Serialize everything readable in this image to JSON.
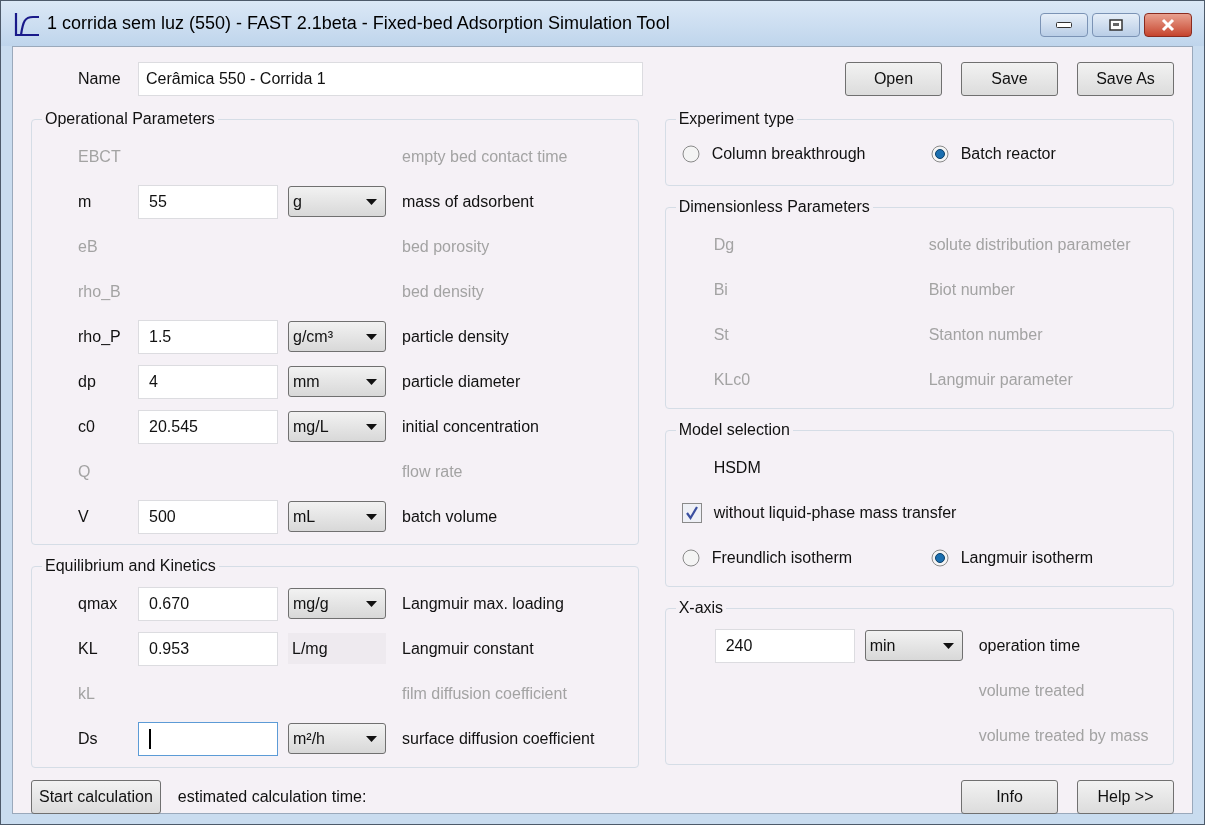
{
  "window": {
    "title": "1 corrida sem luz (550) - FAST 2.1beta - Fixed-bed Adsorption Simulation Tool"
  },
  "name": {
    "label": "Name",
    "value": "Cerâmica 550 - Corrida 1"
  },
  "file_buttons": [
    "Open",
    "Save",
    "Save As"
  ],
  "operational_parameters": {
    "title": "Operational Parameters",
    "rows": [
      {
        "kind": "disabled",
        "symbol": "EBCT",
        "description": "empty bed contact time"
      },
      {
        "kind": "select",
        "symbol": "m",
        "value": "55",
        "unit": "g",
        "description": "mass of adsorbent",
        "focused": false
      },
      {
        "kind": "disabled",
        "symbol": "eB",
        "description": "bed porosity"
      },
      {
        "kind": "disabled",
        "symbol": "rho_B",
        "description": "bed density"
      },
      {
        "kind": "select",
        "symbol": "rho_P",
        "value": "1.5",
        "unit": "g/cm³",
        "description": "particle density",
        "focused": false
      },
      {
        "kind": "select",
        "symbol": "dp",
        "value": "4",
        "unit": "mm",
        "description": "particle diameter",
        "focused": false
      },
      {
        "kind": "select",
        "symbol": "c0",
        "value": "20.545",
        "unit": "mg/L",
        "description": "initial concentration",
        "focused": false
      },
      {
        "kind": "disabled",
        "symbol": "Q",
        "description": "flow rate"
      },
      {
        "kind": "select",
        "symbol": "V",
        "value": "500",
        "unit": "mL",
        "description": "batch volume",
        "focused": false
      }
    ]
  },
  "equilibrium_and_kinetics": {
    "title": "Equilibrium and Kinetics",
    "rows": [
      {
        "kind": "select",
        "symbol": "qmax",
        "value": "0.670",
        "unit": "mg/g",
        "description": "Langmuir max. loading",
        "focused": false
      },
      {
        "kind": "static",
        "symbol": "KL",
        "value": "0.953",
        "unit": "L/mg",
        "description": "Langmuir constant",
        "focused": false
      },
      {
        "kind": "disabled",
        "symbol": "kL",
        "description": "film diffusion coefficient"
      },
      {
        "kind": "select",
        "symbol": "Ds",
        "value": "",
        "unit": "m²/h",
        "description": "surface diffusion coefficient",
        "focused": true
      }
    ]
  },
  "experiment_type": {
    "title": "Experiment type",
    "options": [
      {
        "label": "Column breakthrough",
        "selected": false
      },
      {
        "label": "Batch reactor",
        "selected": true
      }
    ]
  },
  "dimensionless_parameters": {
    "title": "Dimensionless Parameters",
    "rows": [
      {
        "kind": "disabled",
        "symbol": "Dg",
        "description": "solute distribution parameter"
      },
      {
        "kind": "disabled",
        "symbol": "Bi",
        "description": "Biot number"
      },
      {
        "kind": "disabled",
        "symbol": "St",
        "description": "Stanton number"
      },
      {
        "kind": "disabled",
        "symbol": "KLc0",
        "description": "Langmuir parameter"
      }
    ]
  },
  "model_selection": {
    "title": "Model selection",
    "model": "HSDM",
    "checkbox": {
      "label": "without liquid-phase mass transfer",
      "checked": true
    },
    "isotherms": [
      {
        "label": "Freundlich isotherm",
        "selected": false
      },
      {
        "label": "Langmuir isotherm",
        "selected": true
      }
    ]
  },
  "x_axis": {
    "title": "X-axis",
    "rows": [
      {
        "kind": "select",
        "value": "240",
        "unit": "min",
        "description": "operation time",
        "focused": false
      },
      {
        "kind": "disabled",
        "description": "volume treated"
      },
      {
        "kind": "disabled",
        "description": "volume treated by mass"
      }
    ]
  },
  "footer": {
    "start_button": "Start calculation",
    "estimate_label": "estimated calculation time:",
    "buttons": [
      "Info",
      "Help >>"
    ]
  }
}
